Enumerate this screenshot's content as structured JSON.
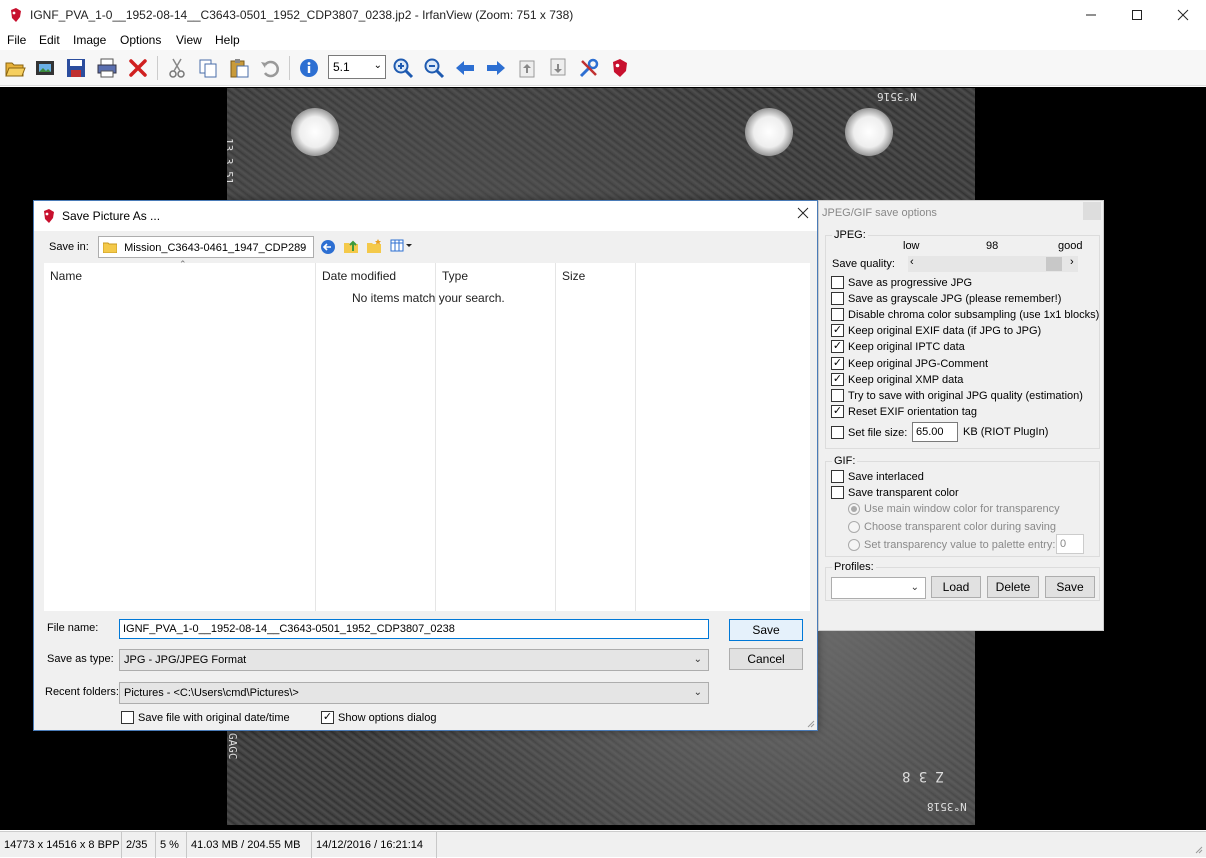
{
  "app": {
    "title": "IGNF_PVA_1-0__1952-08-14__C3643-0501_1952_CDP3807_0238.jp2 - IrfanView (Zoom: 751 x 738)",
    "accent": "#0078d7"
  },
  "menu": [
    "File",
    "Edit",
    "Image",
    "Options",
    "View",
    "Help"
  ],
  "toolbar": {
    "icons": [
      "open-icon",
      "slideshow-icon",
      "save-icon",
      "print-icon",
      "delete-icon",
      "cut-icon",
      "copy-icon",
      "paste-icon",
      "undo-icon",
      "info-icon",
      "zoom-in-icon",
      "zoom-out-icon",
      "previous-icon",
      "next-icon",
      "page-up-icon",
      "page-down-icon",
      "settings-icon",
      "irfanview-icon"
    ],
    "zoom_value": "5.1"
  },
  "photo": {
    "date_stamp": "13.3.51",
    "corner_label_top": "N°3516",
    "corner_label_bottom": "N°3518",
    "side_mark": "GAGC",
    "bottom_right_digits": "Z 3 8"
  },
  "dialog": {
    "title": "Save Picture As ...",
    "save_in_label": "Save in:",
    "save_in_value": "Mission_C3643-0461_1947_CDP289",
    "columns": [
      "Name",
      "Date modified",
      "Type",
      "Size"
    ],
    "empty_message": "No items match your search.",
    "file_name_label": "File name:",
    "file_name_value": "IGNF_PVA_1-0__1952-08-14__C3643-0501_1952_CDP3807_0238",
    "save_as_type_label": "Save as type:",
    "save_as_type_value": "JPG - JPG/JPEG Format",
    "recent_folders_label": "Recent folders:",
    "recent_folders_value": "Pictures  -  <C:\\Users\\cmd\\Pictures\\>",
    "save_button": "Save",
    "cancel_button": "Cancel",
    "checkbox_original_date": "Save file with original date/time",
    "checkbox_show_options": "Show options dialog"
  },
  "options": {
    "title": "JPEG/GIF save options",
    "jpeg_group": "JPEG:",
    "quality_low": "low",
    "quality_value": "98",
    "quality_good": "good",
    "quality_label": "Save quality:",
    "checkboxes": [
      {
        "label": "Save as progressive JPG",
        "checked": false
      },
      {
        "label": "Save as grayscale JPG (please remember!)",
        "checked": false
      },
      {
        "label": "Disable chroma color subsampling (use 1x1 blocks)",
        "checked": false
      },
      {
        "label": "Keep original EXIF data (if JPG to JPG)",
        "checked": true
      },
      {
        "label": "Keep original IPTC data",
        "checked": true
      },
      {
        "label": "Keep original JPG-Comment",
        "checked": true
      },
      {
        "label": "Keep original XMP data",
        "checked": true
      },
      {
        "label": "Try to save with original JPG quality (estimation)",
        "checked": false
      },
      {
        "label": "Reset EXIF orientation tag",
        "checked": true
      }
    ],
    "file_size_label": "Set file size:",
    "file_size_value": "65.00",
    "file_size_unit": "KB (RIOT PlugIn)",
    "gif_group": "GIF:",
    "gif_interlaced": "Save interlaced",
    "gif_transparent": "Save transparent color",
    "radio_main_window": "Use main window color for transparency",
    "radio_choose": "Choose transparent color during saving",
    "radio_palette": "Set transparency value to palette entry:",
    "palette_entry_value": "0",
    "profiles_label": "Profiles:",
    "load_button": "Load",
    "delete_button": "Delete",
    "save_button": "Save"
  },
  "status": {
    "dimensions": "14773 x 14516 x 8 BPP",
    "index": "2/35",
    "zoom": "5 %",
    "memory": "41.03 MB / 204.55 MB",
    "datetime": "14/12/2016 / 16:21:14"
  }
}
